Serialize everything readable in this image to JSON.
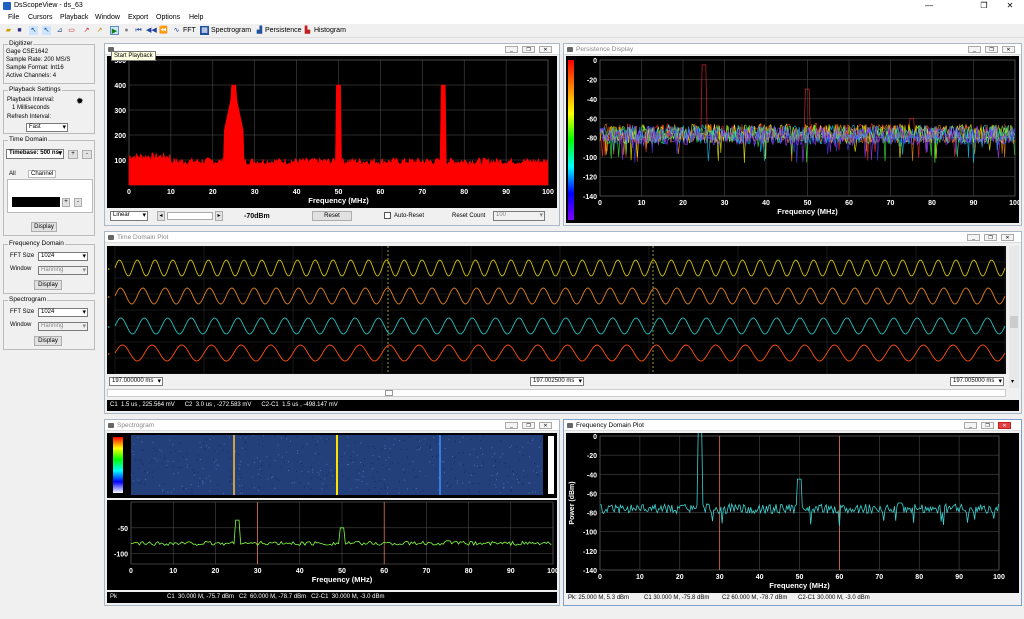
{
  "app": {
    "title": "DsScopeView - ds_63"
  },
  "menu": [
    "File",
    "Cursors",
    "Playback",
    "Window",
    "Export",
    "Options",
    "Help"
  ],
  "toolbar": {
    "fft": "FFT",
    "spectrogram": "Spectrogram",
    "persistence": "Persistence",
    "histogram": "Histogram",
    "tooltip": "Start Playback"
  },
  "digitizer": {
    "title": "Digitizer",
    "lines": [
      "Gage CSE1642",
      "Sample Rate: 200 MS/S",
      "Sample Format: Int16",
      "Active Channels: 4"
    ]
  },
  "playback": {
    "title": "Playback Settings",
    "interval_label": "Playback Interval:",
    "interval_value": "1 Milliseconds",
    "refresh_label": "Refresh Interval:",
    "refresh_value": "Fast"
  },
  "time_domain": {
    "title": "Time Domain",
    "timebase": "Timebase: 500 ns",
    "tab_all": "All",
    "tab_channel": "Channel",
    "display": "Display"
  },
  "freq_domain": {
    "title": "Frequency Domain",
    "fft_label": "FFT Size",
    "fft_value": "1024",
    "window_label": "Window",
    "window_value": "Hanning",
    "display": "Display"
  },
  "spectro_settings": {
    "title": "Spectrogram",
    "fft_label": "FFT Size",
    "fft_value": "1024",
    "window_label": "Window",
    "window_value": "Hanning",
    "display": "Display"
  },
  "histogram_win": {
    "title": "",
    "xlabel": "Frequency (MHz)",
    "scale": "Linear",
    "level": "-70dBm",
    "reset": "Reset",
    "auto_reset": "Auto-Reset",
    "reset_count_label": "Reset Count",
    "reset_count_value": "100"
  },
  "persistence_win": {
    "title": "Persistence Display",
    "xlabel": "Frequency (MHz)"
  },
  "time_plot": {
    "title": "Time Domain Plot",
    "t_left": "197.000000 ms",
    "t_mid": "197.002500 ms",
    "t_right": "197.005000 ms",
    "status": "C1  1.5 us , 225.564 mV      C2  3.0 us , -272.583 mV      C2-C1  1.5 us , -498.147 mV"
  },
  "spectrogram_win": {
    "title": "Spectrogram",
    "xlabel": "Frequency (MHz)",
    "status": "Pk                              C1  30.000 M, -75.7 dBm   C2  60.000 M, -78.7 dBm   C2-C1  30.000 M, -3.0 dBm"
  },
  "freq_plot": {
    "title": "Frequency Domain Plot",
    "xlabel": "Frequency (MHz)",
    "ylabel": "Power (dBm)",
    "status_pk": "Pk: 25.000 M, 5.3 dBm",
    "status_c1": "C1  30.000 M, -75.8 dBm",
    "status_c2": "C2  60.000 M, -78.7 dBm",
    "status_diff": "C2-C1  30.000 M, -3.0 dBm"
  },
  "chart_data": [
    {
      "type": "bar",
      "title": "",
      "xlabel": "Frequency (MHz)",
      "xlim": [
        0,
        100
      ],
      "ylim": [
        0,
        500
      ],
      "yticks": [
        100,
        200,
        300,
        400,
        500
      ],
      "xticks": [
        0,
        10,
        20,
        30,
        40,
        50,
        60,
        70,
        80,
        90,
        100
      ],
      "peaks": [
        {
          "x": 25,
          "y": 400
        },
        {
          "x": 50,
          "y": 400
        },
        {
          "x": 75,
          "y": 400
        }
      ],
      "floor": 90,
      "color": "#ff0000"
    },
    {
      "type": "line",
      "title": "",
      "xlabel": "Frequency (MHz)",
      "xlim": [
        0,
        100
      ],
      "ylim": [
        -140,
        0
      ],
      "yticks": [
        0,
        -20,
        -40,
        -60,
        -80,
        -100,
        -120,
        -140
      ],
      "xticks": [
        0,
        10,
        20,
        30,
        40,
        50,
        60,
        70,
        80,
        90,
        100
      ],
      "floor": -75,
      "peaks": [
        {
          "x": 25,
          "y": -5
        },
        {
          "x": 50,
          "y": -30
        },
        {
          "x": 75,
          "y": -60
        }
      ]
    },
    {
      "type": "line",
      "title": "",
      "series": [
        {
          "name": "",
          "color": "#d4c000"
        },
        {
          "name": "",
          "color": "#e08020"
        },
        {
          "name": "",
          "color": "#20c0c0"
        },
        {
          "name": "",
          "color": "#ff5010"
        }
      ],
      "cycles": [
        50,
        40,
        38,
        30
      ]
    },
    {
      "type": "line",
      "title": "",
      "xlabel": "Frequency (MHz)",
      "xlim": [
        0,
        100
      ],
      "ylim": [
        -120,
        0
      ],
      "yticks": [
        -50,
        -100
      ],
      "xticks": [
        0,
        10,
        20,
        30,
        40,
        50,
        60,
        70,
        80,
        90,
        100
      ],
      "floor": -80,
      "peaks": [
        {
          "x": 25,
          "y": -35
        },
        {
          "x": 50,
          "y": -50
        },
        {
          "x": 75,
          "y": -75
        }
      ],
      "color": "#80ff40"
    },
    {
      "type": "line",
      "title": "",
      "xlabel": "Frequency (MHz)",
      "ylabel": "Power (dBm)",
      "xlim": [
        0,
        100
      ],
      "ylim": [
        -140,
        0
      ],
      "yticks": [
        0,
        -20,
        -40,
        -60,
        -80,
        -100,
        -120,
        -140
      ],
      "xticks": [
        0,
        10,
        20,
        30,
        40,
        50,
        60,
        70,
        80,
        90,
        100
      ],
      "floor": -76,
      "peaks": [
        {
          "x": 25,
          "y": 5
        },
        {
          "x": 50,
          "y": -45
        },
        {
          "x": 75,
          "y": -70
        }
      ],
      "cursors": [
        30,
        60
      ],
      "color": "#40d0d0"
    }
  ]
}
